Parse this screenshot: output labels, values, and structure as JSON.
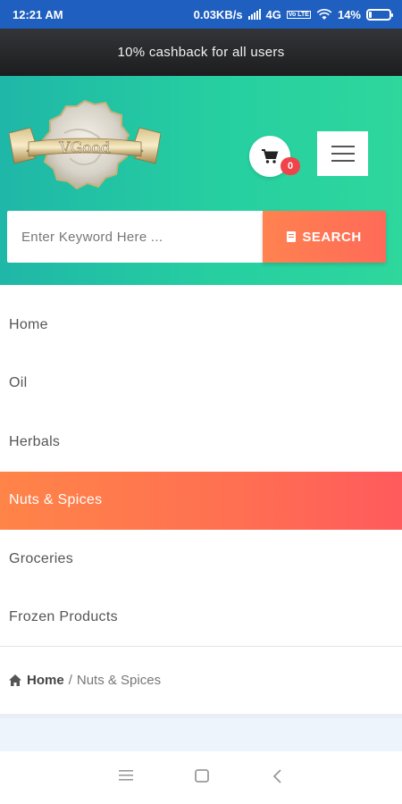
{
  "status_bar": {
    "time": "12:21 AM",
    "network_speed": "0.03KB/s",
    "network_type": "4G",
    "volte": "Vo LTE",
    "battery": "14%"
  },
  "promo": {
    "text": "10% cashback for all users"
  },
  "header": {
    "logo_text": "VGood",
    "cart_count": "0",
    "search": {
      "placeholder": "Enter Keyword Here ...",
      "button_label": "SEARCH"
    }
  },
  "nav": {
    "items": [
      {
        "label": "Home",
        "active": false
      },
      {
        "label": "Oil",
        "active": false
      },
      {
        "label": "Herbals",
        "active": false
      },
      {
        "label": "Nuts & Spices",
        "active": true
      },
      {
        "label": "Groceries",
        "active": false
      },
      {
        "label": "Frozen Products",
        "active": false
      }
    ]
  },
  "breadcrumb": {
    "home": "Home",
    "separator": "/",
    "current": "Nuts & Spices"
  },
  "colors": {
    "status_bar": "#1f5fbf",
    "header_gradient_start": "#1fb7a8",
    "header_gradient_end": "#2ed79c",
    "accent_orange": "#ff7454",
    "badge_red": "#f0434a"
  },
  "icons": {
    "cart": "cart-icon",
    "menu": "hamburger-menu-icon",
    "search": "document-icon",
    "breadcrumb_home": "home-icon"
  }
}
